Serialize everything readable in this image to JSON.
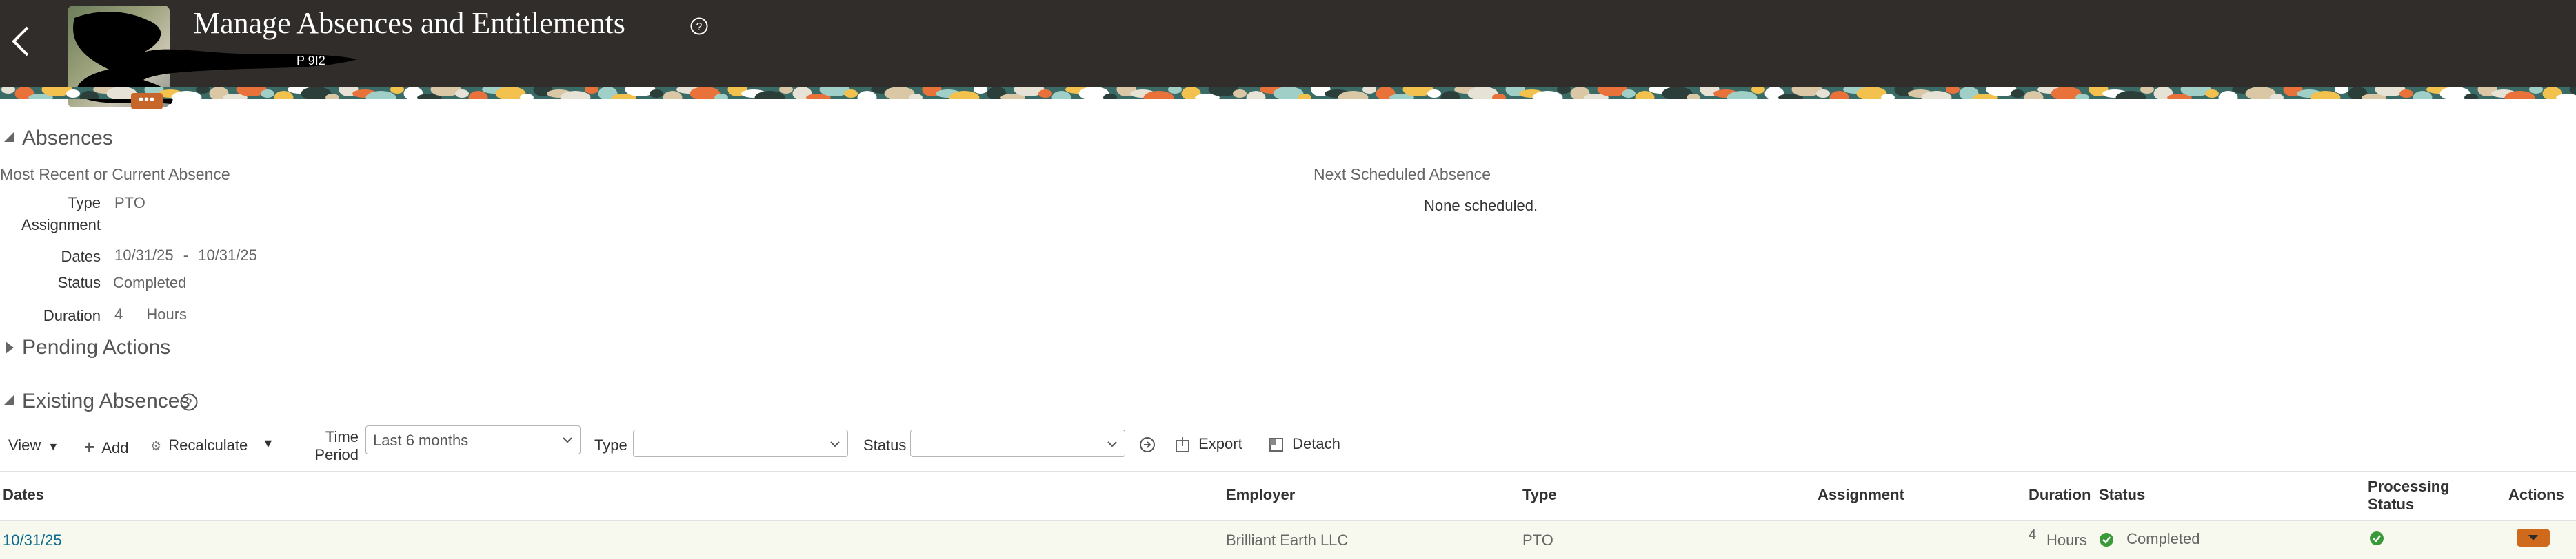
{
  "header": {
    "title": "Manage Absences and Entitlements",
    "subtitle_fragment": "P 9I2",
    "avatar_menu_glyph": "•••",
    "colors": {
      "bar": "#312d2a",
      "accent": "#c7662b"
    }
  },
  "absences": {
    "section_title": "Absences",
    "current": {
      "heading": "Most Recent or Current Absence",
      "type_label": "Type",
      "type_value": "PTO",
      "assignment_label": "Assignment",
      "dates_label": "Dates",
      "dates_start": "10/31/25",
      "dates_sep": "-",
      "dates_end": "10/31/25",
      "status_label": "Status",
      "status_value": "Completed",
      "duration_label": "Duration",
      "duration_value": "4",
      "duration_unit": "Hours"
    },
    "next": {
      "heading": "Next Scheduled Absence",
      "value": "None scheduled."
    }
  },
  "pending": {
    "section_title": "Pending Actions"
  },
  "existing": {
    "section_title": "Existing Absences",
    "toolbar": {
      "view_label": "View",
      "add_label": "Add",
      "recalculate_label": "Recalculate",
      "time_period_label_line1": "Time",
      "time_period_label_line2": "Period",
      "time_period_value": "Last 6 months",
      "type_label": "Type",
      "type_value": "",
      "status_label": "Status",
      "status_value": "",
      "export_label": "Export",
      "detach_label": "Detach"
    },
    "columns": {
      "dates": "Dates",
      "employer": "Employer",
      "type": "Type",
      "assignment": "Assignment",
      "duration": "Duration",
      "status": "Status",
      "processing_line1": "Processing",
      "processing_line2": "Status",
      "actions": "Actions"
    },
    "rows": [
      {
        "dates": "10/31/25",
        "employer": "Brilliant Earth LLC",
        "type": "PTO",
        "assignment": "",
        "duration_value": "4",
        "duration_unit": "Hours",
        "status": "Completed",
        "status_icon": "check-circle-icon",
        "processing_icon": "check-circle-icon",
        "status_color": "#3a9a3a"
      }
    ]
  }
}
